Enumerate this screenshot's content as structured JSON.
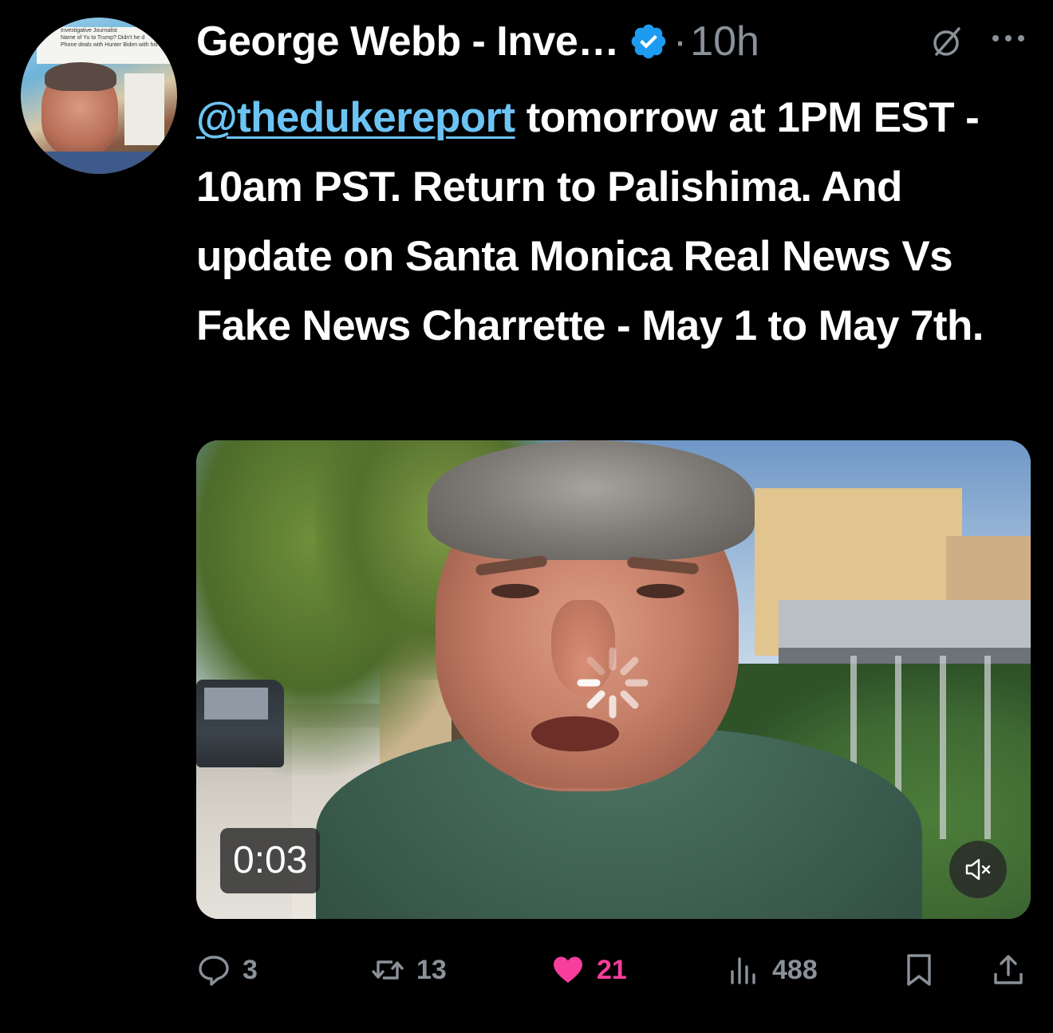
{
  "author": {
    "display_name": "George Webb - Inve…",
    "avatar_text": [
      "Investigative Journalist",
      "Name of Yu to Trump? Didn't he d",
      "Phone deals with Hunter Biden with his e"
    ]
  },
  "meta": {
    "separator": "·",
    "timestamp": "10h"
  },
  "tweet": {
    "mention": "@thedukereport",
    "text": " tomorrow at 1PM EST - 10am PST.  Return to Palishima. And update on Santa Monica Real News Vs Fake News Charrette - May 1 to May 7th."
  },
  "media": {
    "duration": "0:03",
    "muted": true
  },
  "actions": {
    "replies": "3",
    "reposts": "13",
    "likes": "21",
    "views": "488"
  },
  "icons": {
    "verified": "verified-badge-icon",
    "grok": "grok-icon",
    "more": "more-icon",
    "reply": "reply-icon",
    "repost": "repost-icon",
    "like": "heart-icon",
    "views": "views-icon",
    "bookmark": "bookmark-icon",
    "share": "share-icon",
    "spinner": "loading-spinner-icon",
    "mute": "mute-icon"
  },
  "colors": {
    "background": "#000000",
    "text": "#ffffff",
    "muted": "#8b9199",
    "link": "#6cc4f5",
    "verified": "#1d9bf0",
    "like_active": "#f73e9d"
  }
}
